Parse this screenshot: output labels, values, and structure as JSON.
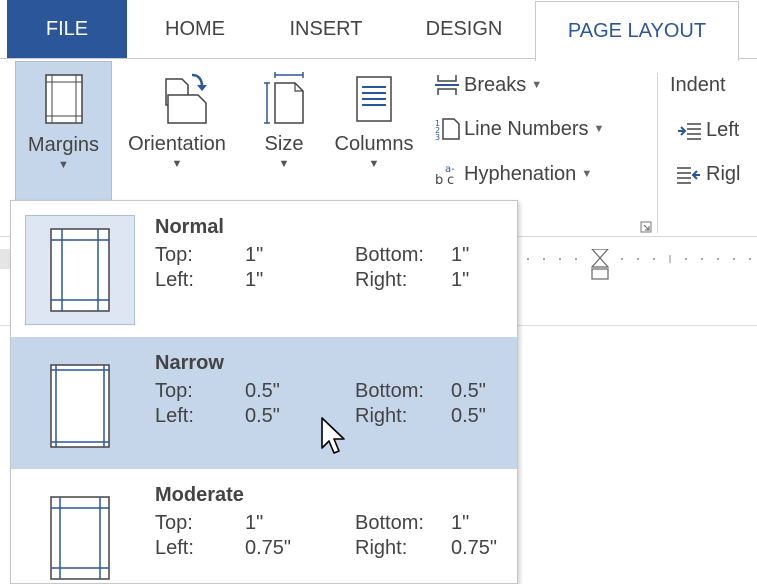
{
  "tabs": {
    "file": "FILE",
    "home": "HOME",
    "insert": "INSERT",
    "design": "DESIGN",
    "page_layout": "PAGE LAYOUT"
  },
  "ribbon": {
    "margins": "Margins",
    "orientation": "Orientation",
    "size": "Size",
    "columns": "Columns",
    "breaks": "Breaks",
    "line_numbers": "Line Numbers",
    "hyphenation": "Hyphenation",
    "indent_heading": "Indent",
    "indent_left": "Left",
    "indent_right": "Rigl"
  },
  "margin_options": [
    {
      "name": "Normal",
      "top_label": "Top:",
      "top": "1\"",
      "bottom_label": "Bottom:",
      "bottom": "1\"",
      "left_label": "Left:",
      "left": "1\"",
      "right_label": "Right:",
      "right": "1\""
    },
    {
      "name": "Narrow",
      "top_label": "Top:",
      "top": "0.5\"",
      "bottom_label": "Bottom:",
      "bottom": "0.5\"",
      "left_label": "Left:",
      "left": "0.5\"",
      "right_label": "Right:",
      "right": "0.5\""
    },
    {
      "name": "Moderate",
      "top_label": "Top:",
      "top": "1\"",
      "bottom_label": "Bottom:",
      "bottom": "1\"",
      "left_label": "Left:",
      "left": "0.75\"",
      "right_label": "Right:",
      "right": "0.75\""
    }
  ],
  "colors": {
    "file_tab": "#2b579a",
    "active_tab_text": "#2b579a",
    "selected_bg": "#c5d5ea",
    "icon_stroke": "#444444",
    "icon_accent": "#2b579a"
  }
}
